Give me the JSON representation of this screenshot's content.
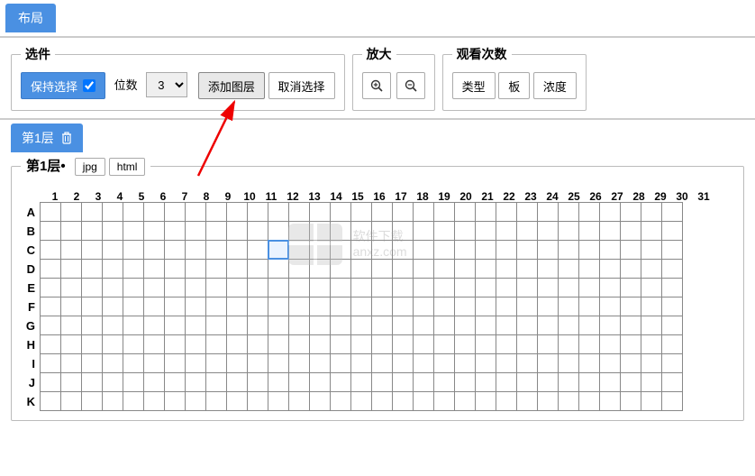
{
  "tab": {
    "layout": "布局"
  },
  "selection": {
    "legend": "选件",
    "keep_selection": "保持选择",
    "keep_checked": true,
    "digits_label": "位数",
    "digits_value": "3",
    "add_layer": "添加图层",
    "cancel_selection": "取消选择"
  },
  "zoom": {
    "legend": "放大"
  },
  "views": {
    "legend": "观看次数",
    "type": "类型",
    "board": "板",
    "density": "浓度"
  },
  "layer": {
    "tab_label": "第1层",
    "fieldset_legend": "第1层•",
    "jpg": "jpg",
    "html": "html"
  },
  "grid": {
    "cols": [
      "1",
      "2",
      "3",
      "4",
      "5",
      "6",
      "7",
      "8",
      "9",
      "10",
      "11",
      "12",
      "13",
      "14",
      "15",
      "16",
      "17",
      "18",
      "19",
      "20",
      "21",
      "22",
      "23",
      "24",
      "25",
      "26",
      "27",
      "28",
      "29",
      "30",
      "31"
    ],
    "rows": [
      "A",
      "B",
      "C",
      "D",
      "E",
      "F",
      "G",
      "H",
      "I",
      "J",
      "K"
    ],
    "selected": {
      "row": "C",
      "col": "12"
    }
  },
  "watermark": {
    "line1": "软件下载",
    "line2": "anxz.com"
  }
}
